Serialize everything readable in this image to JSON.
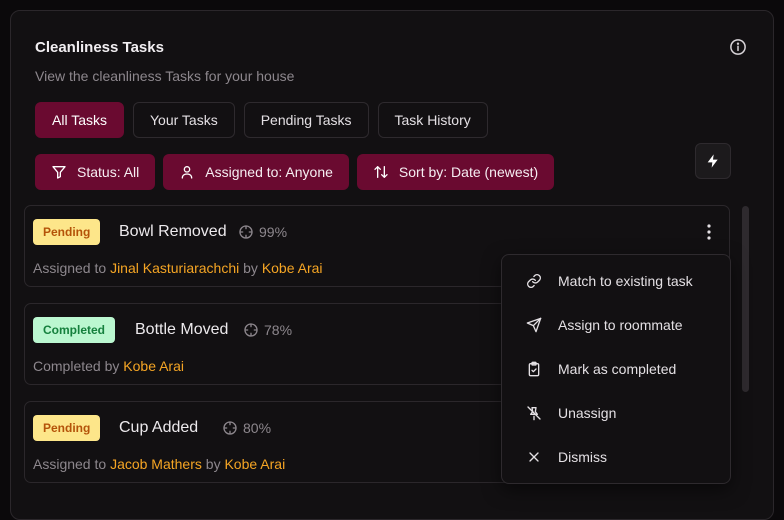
{
  "header": {
    "title": "Cleanliness Tasks",
    "subtitle": "View the cleanliness Tasks for your house",
    "info_icon": "info-icon"
  },
  "tabs": [
    {
      "label": "All Tasks",
      "active": true
    },
    {
      "label": "Your Tasks",
      "active": false
    },
    {
      "label": "Pending Tasks",
      "active": false
    },
    {
      "label": "Task History",
      "active": false
    }
  ],
  "filters": {
    "status": "Status: All",
    "assigned": "Assigned to: Anyone",
    "sort": "Sort by: Date (newest)",
    "quick_action_icon": "bolt-icon"
  },
  "tasks": [
    {
      "status": "Pending",
      "name": "Bowl Removed",
      "confidence": "99%",
      "prefix": "Assigned to",
      "person": "Jinal Kasturiarachchi",
      "by": "by",
      "author": "Kobe Arai"
    },
    {
      "status": "Completed",
      "name": "Bottle Moved",
      "confidence": "78%",
      "prefix": "Completed by",
      "author": "Kobe Arai"
    },
    {
      "status": "Pending",
      "name": "Cup Added",
      "confidence": "80%",
      "prefix": "Assigned to",
      "person": "Jacob Mathers",
      "by": "by",
      "author": "Kobe Arai"
    }
  ],
  "menu": {
    "items": [
      {
        "label": "Match to existing task",
        "icon": "link-icon"
      },
      {
        "label": "Assign to roommate",
        "icon": "send-icon"
      },
      {
        "label": "Mark as completed",
        "icon": "clipboard-check-icon"
      },
      {
        "label": "Unassign",
        "icon": "pin-off-icon"
      },
      {
        "label": "Dismiss",
        "icon": "x-icon"
      }
    ]
  },
  "colors": {
    "accent": "#6a0a30",
    "highlight": "#f5a524",
    "pending_bg": "#fde68a",
    "completed_bg": "#bbf7d0"
  }
}
